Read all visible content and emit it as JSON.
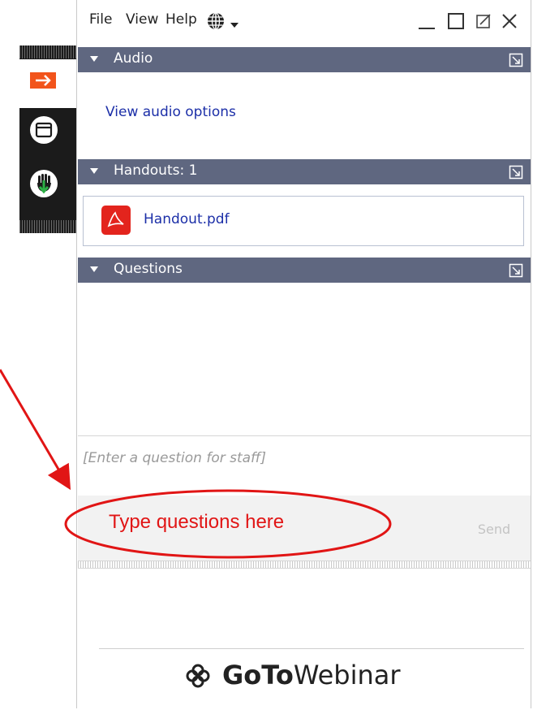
{
  "menu": {
    "file": "File",
    "view": "View",
    "help": "Help"
  },
  "sections": {
    "audio": {
      "title": "Audio",
      "link": "View audio options"
    },
    "handouts": {
      "title": "Handouts: 1",
      "file": "Handout.pdf"
    },
    "questions": {
      "title": "Questions",
      "placeholder": "[Enter a question for staff]",
      "send_label": "Send"
    }
  },
  "branding": {
    "go": "GoTo",
    "rest": "Webinar"
  },
  "annotation": {
    "text": "Type questions here",
    "color": "#e11515"
  },
  "colors": {
    "header": "#5f6780",
    "link": "#1c2fa8",
    "accent_orange": "#f2541b"
  }
}
